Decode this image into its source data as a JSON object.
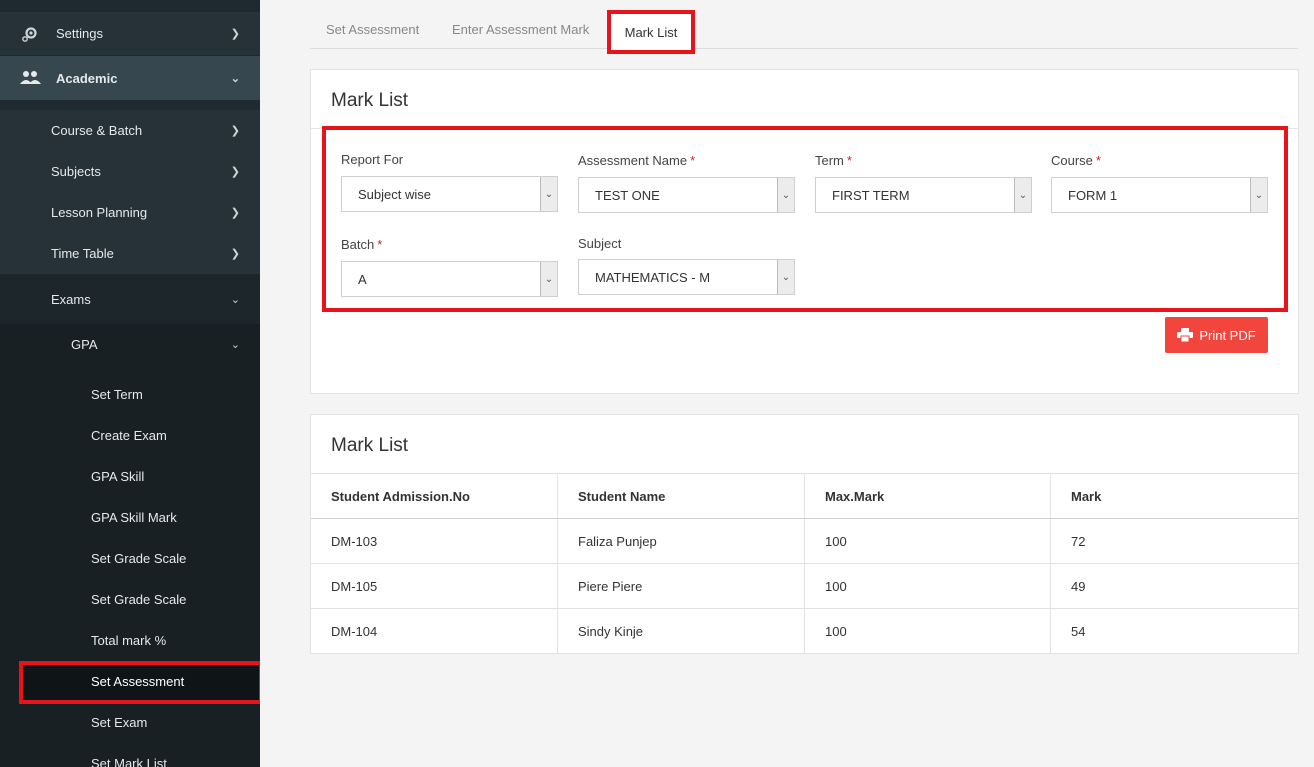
{
  "sidebar": {
    "settings": "Settings",
    "academic": "Academic",
    "course_batch": "Course & Batch",
    "subjects": "Subjects",
    "lesson_planning": "Lesson Planning",
    "time_table": "Time Table",
    "exams": "Exams",
    "gpa": "GPA",
    "gpa_items": [
      "Set Term",
      "Create Exam",
      "GPA Skill",
      "GPA Skill Mark",
      "Set Grade Scale",
      "Set Grade Scale",
      "Total mark %",
      "Set Assessment",
      "Set Exam",
      "Set Mark List"
    ]
  },
  "tabs": {
    "set_assessment": "Set Assessment",
    "enter_assessment_mark": "Enter Assessment Mark",
    "mark_list": "Mark List"
  },
  "filter_card": {
    "title": "Mark List",
    "report_for_label": "Report For",
    "report_for_value": "Subject wise",
    "assessment_name_label": "Assessment Name",
    "assessment_name_value": "TEST ONE",
    "term_label": "Term",
    "term_value": "FIRST TERM",
    "course_label": "Course",
    "course_value": "FORM 1",
    "batch_label": "Batch",
    "batch_value": "A",
    "subject_label": "Subject",
    "subject_value": "MATHEMATICS - M",
    "required_mark": "*",
    "print_label": "Print PDF"
  },
  "table_card": {
    "title": "Mark List",
    "headers": [
      "Student Admission.No",
      "Student Name",
      "Max.Mark",
      "Mark"
    ],
    "rows": [
      [
        "DM-103",
        "Faliza Punjep",
        "100",
        "72"
      ],
      [
        "DM-105",
        "Piere Piere",
        "100",
        "49"
      ],
      [
        "DM-104",
        "Sindy Kinje",
        "100",
        "54"
      ]
    ]
  },
  "colors": {
    "sidebar_bg": "#1f2a30",
    "highlight": "#e8141c",
    "print_button": "#f2453d"
  },
  "icons": [
    "gear-icon",
    "users-icon",
    "chevron-right-icon",
    "chevron-down-icon",
    "printer-icon",
    "select-arrow-icon"
  ]
}
